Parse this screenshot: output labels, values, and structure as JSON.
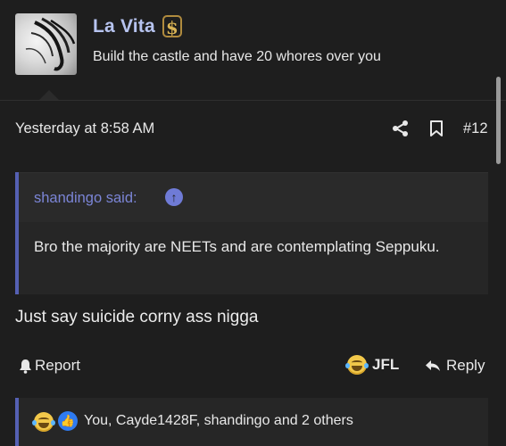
{
  "post": {
    "username": "La Vita",
    "user_title": "Build the castle and have 20 whores over you",
    "timestamp": "Yesterday at 8:58 AM",
    "post_number": "#12",
    "quote": {
      "author": "shandingo said:",
      "text": "Bro the majority are NEETs and are contemplating Seppuku."
    },
    "body": "Just say suicide corny ass nigga",
    "actions": {
      "report": "Report",
      "reaction": "JFL",
      "reply": "Reply"
    },
    "reactions_summary": "You, Cayde1428F, shandingo and 2 others"
  },
  "icons": {
    "badge": "dollar-badge-icon",
    "share": "share-icon",
    "bookmark": "bookmark-icon",
    "quote_jump": "arrow-up-circle-icon",
    "report": "bell-icon",
    "reaction": "laughing-crying-emoji-icon",
    "reply": "reply-arrow-icon",
    "like": "thumbs-up-icon"
  },
  "colors": {
    "background": "#1e1e1e",
    "username": "#b7c4f0",
    "accent_quote_border": "#5560b3",
    "quote_author": "#7b85d6",
    "badge_gold": "#d8b356"
  }
}
